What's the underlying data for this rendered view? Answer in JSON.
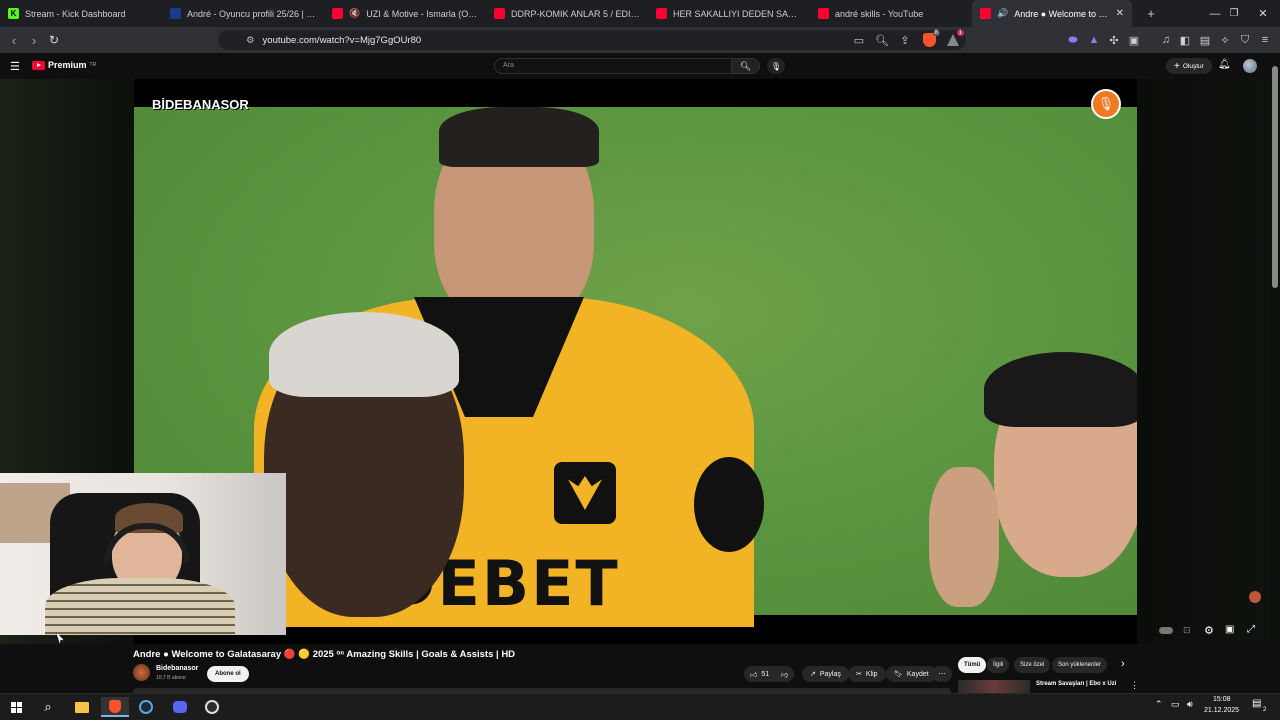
{
  "browser": {
    "tabs": [
      {
        "title": "Stream - Kick Dashboard",
        "color": "#53fc18"
      },
      {
        "title": "André - Oyuncu profili 25/26 | Transf",
        "color": "#1a3c8a"
      },
      {
        "title": "UZI & Motive - Ismarla (Official V",
        "color": "#ff0033"
      },
      {
        "title": "DDRP-KOMIK ANLAR 5 / EDITLI - Yo",
        "color": "#ff0033"
      },
      {
        "title": "HER SAKALLIYI DEDEN SANMA | 5Si",
        "color": "#ff0033"
      },
      {
        "title": "andré skills - YouTube",
        "color": "#ff0033"
      },
      {
        "title": "Andre ● Welcome to Galatas",
        "color": "#ff0033"
      }
    ],
    "url": "youtube.com/watch?v=Mjg7GgOUr80",
    "shield_badge": "8",
    "alert_badge": "1"
  },
  "youtube": {
    "logo_text": "Premium",
    "logo_sup": "TR",
    "search_placeholder": "Ara",
    "create_label": "Oluştur"
  },
  "video": {
    "watermark": "BİDEBANASOR",
    "title": "Andre ● Welcome to Galatasaray 🔴 🟡 2025 ᵒⁿ Amazing Skills | Goals & Assists | HD",
    "jersey_text": "DEBET"
  },
  "channel": {
    "name": "Bidebanasor",
    "subs": "10,7 B abone",
    "subscribe_label": "Abone ol"
  },
  "actions": {
    "likes": "51",
    "share": "Paylaş",
    "clip": "Klip",
    "save": "Kaydet"
  },
  "filters": [
    "Tümü",
    "İlgili",
    "Size özel",
    "Son yüklenenler"
  ],
  "recommendation": {
    "title": "Stream Savaşları | Ebo x Uzi"
  },
  "taskbar": {
    "time": "15:08",
    "date": "21.12.2025",
    "notif": "2"
  },
  "colors": {
    "accent_red": "#ff0033",
    "jersey": "#f2b324",
    "pitch": "#5c9640"
  }
}
